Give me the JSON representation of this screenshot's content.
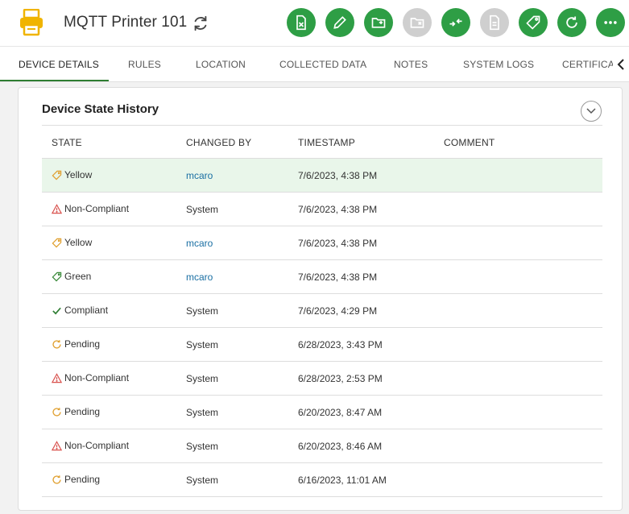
{
  "header": {
    "title": "MQTT Printer 101",
    "actions": [
      {
        "name": "unassign-action-button",
        "icon": "file-x-icon",
        "enabled": true
      },
      {
        "name": "edit-action-button",
        "icon": "pencil-icon",
        "enabled": true
      },
      {
        "name": "move-action-button",
        "icon": "folder-arrow-icon",
        "enabled": true
      },
      {
        "name": "remove-folder-action-button",
        "icon": "folder-x-icon",
        "enabled": false
      },
      {
        "name": "transfer-action-button",
        "icon": "swap-arrows-icon",
        "enabled": true
      },
      {
        "name": "document-action-button",
        "icon": "document-icon",
        "enabled": false
      },
      {
        "name": "tag-action-button",
        "icon": "tag-icon",
        "enabled": true
      },
      {
        "name": "reload-action-button",
        "icon": "reload-icon",
        "enabled": true
      },
      {
        "name": "more-action-button",
        "icon": "ellipsis-icon",
        "enabled": true
      }
    ]
  },
  "tabs": [
    "DEVICE DETAILS",
    "RULES",
    "LOCATION",
    "COLLECTED DATA",
    "NOTES",
    "SYSTEM LOGS",
    "CERTIFICAT"
  ],
  "card": {
    "title": "Device State History",
    "columns": [
      "STATE",
      "CHANGED BY",
      "TIMESTAMP",
      "COMMENT"
    ],
    "rows": [
      {
        "state": "Yellow",
        "icon": "tag-icon",
        "color": "#e0a030",
        "by": "mcaro",
        "link": true,
        "ts": "7/6/2023, 4:38 PM",
        "comment": ""
      },
      {
        "state": "Non-Compliant",
        "icon": "warning-icon",
        "color": "#d9534f",
        "by": "System",
        "link": false,
        "ts": "7/6/2023, 4:38 PM",
        "comment": ""
      },
      {
        "state": "Yellow",
        "icon": "tag-icon",
        "color": "#e0a030",
        "by": "mcaro",
        "link": true,
        "ts": "7/6/2023, 4:38 PM",
        "comment": ""
      },
      {
        "state": "Green",
        "icon": "tag-icon",
        "color": "#3a8a3a",
        "by": "mcaro",
        "link": true,
        "ts": "7/6/2023, 4:38 PM",
        "comment": ""
      },
      {
        "state": "Compliant",
        "icon": "check-icon",
        "color": "#2e7d32",
        "by": "System",
        "link": false,
        "ts": "7/6/2023, 4:29 PM",
        "comment": ""
      },
      {
        "state": "Pending",
        "icon": "pending-icon",
        "color": "#e0a030",
        "by": "System",
        "link": false,
        "ts": "6/28/2023, 3:43 PM",
        "comment": ""
      },
      {
        "state": "Non-Compliant",
        "icon": "warning-icon",
        "color": "#d9534f",
        "by": "System",
        "link": false,
        "ts": "6/28/2023, 2:53 PM",
        "comment": ""
      },
      {
        "state": "Pending",
        "icon": "pending-icon",
        "color": "#e0a030",
        "by": "System",
        "link": false,
        "ts": "6/20/2023, 8:47 AM",
        "comment": ""
      },
      {
        "state": "Non-Compliant",
        "icon": "warning-icon",
        "color": "#d9534f",
        "by": "System",
        "link": false,
        "ts": "6/20/2023, 8:46 AM",
        "comment": ""
      },
      {
        "state": "Pending",
        "icon": "pending-icon",
        "color": "#e0a030",
        "by": "System",
        "link": false,
        "ts": "6/16/2023, 11:01 AM",
        "comment": ""
      }
    ]
  },
  "colors": {
    "accent": "#2e9e45",
    "disabled": "#cfcfcf",
    "link": "#1a6fa3",
    "highlight": "#e9f6ea"
  }
}
